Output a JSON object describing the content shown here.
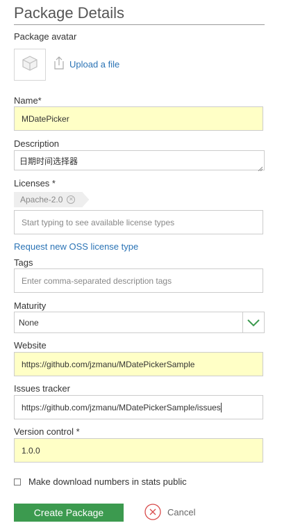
{
  "page": {
    "title": "Package Details"
  },
  "avatar": {
    "label": "Package avatar",
    "upload_label": "Upload a file",
    "icon": "box-icon"
  },
  "name": {
    "label": "Name*",
    "value": "MDatePicker"
  },
  "description": {
    "label": "Description",
    "value": "日期时间选择器"
  },
  "licenses": {
    "label": "Licenses *",
    "tags": [
      "Apache-2.0"
    ],
    "placeholder": "Start typing to see available license types",
    "request_link": "Request new OSS license type"
  },
  "tags": {
    "label": "Tags",
    "placeholder": "Enter comma-separated description tags"
  },
  "maturity": {
    "label": "Maturity",
    "selected": "None"
  },
  "website": {
    "label": "Website",
    "value": "https://github.com/jzmanu/MDatePickerSample"
  },
  "issues": {
    "label": "Issues tracker",
    "value": "https://github.com/jzmanu/MDatePickerSample/issues"
  },
  "version_control": {
    "label": "Version control *",
    "value": "1.0.0"
  },
  "stats": {
    "checkbox_label": "Make download numbers in stats public",
    "checked": false
  },
  "actions": {
    "create_label": "Create Package",
    "cancel_label": "Cancel"
  },
  "colors": {
    "accent_link": "#2a73b5",
    "create_button": "#3c9a4f",
    "highlight_field": "#ffffc6",
    "cancel_icon": "#d84a4a",
    "select_arrow": "#3c9a4f"
  }
}
